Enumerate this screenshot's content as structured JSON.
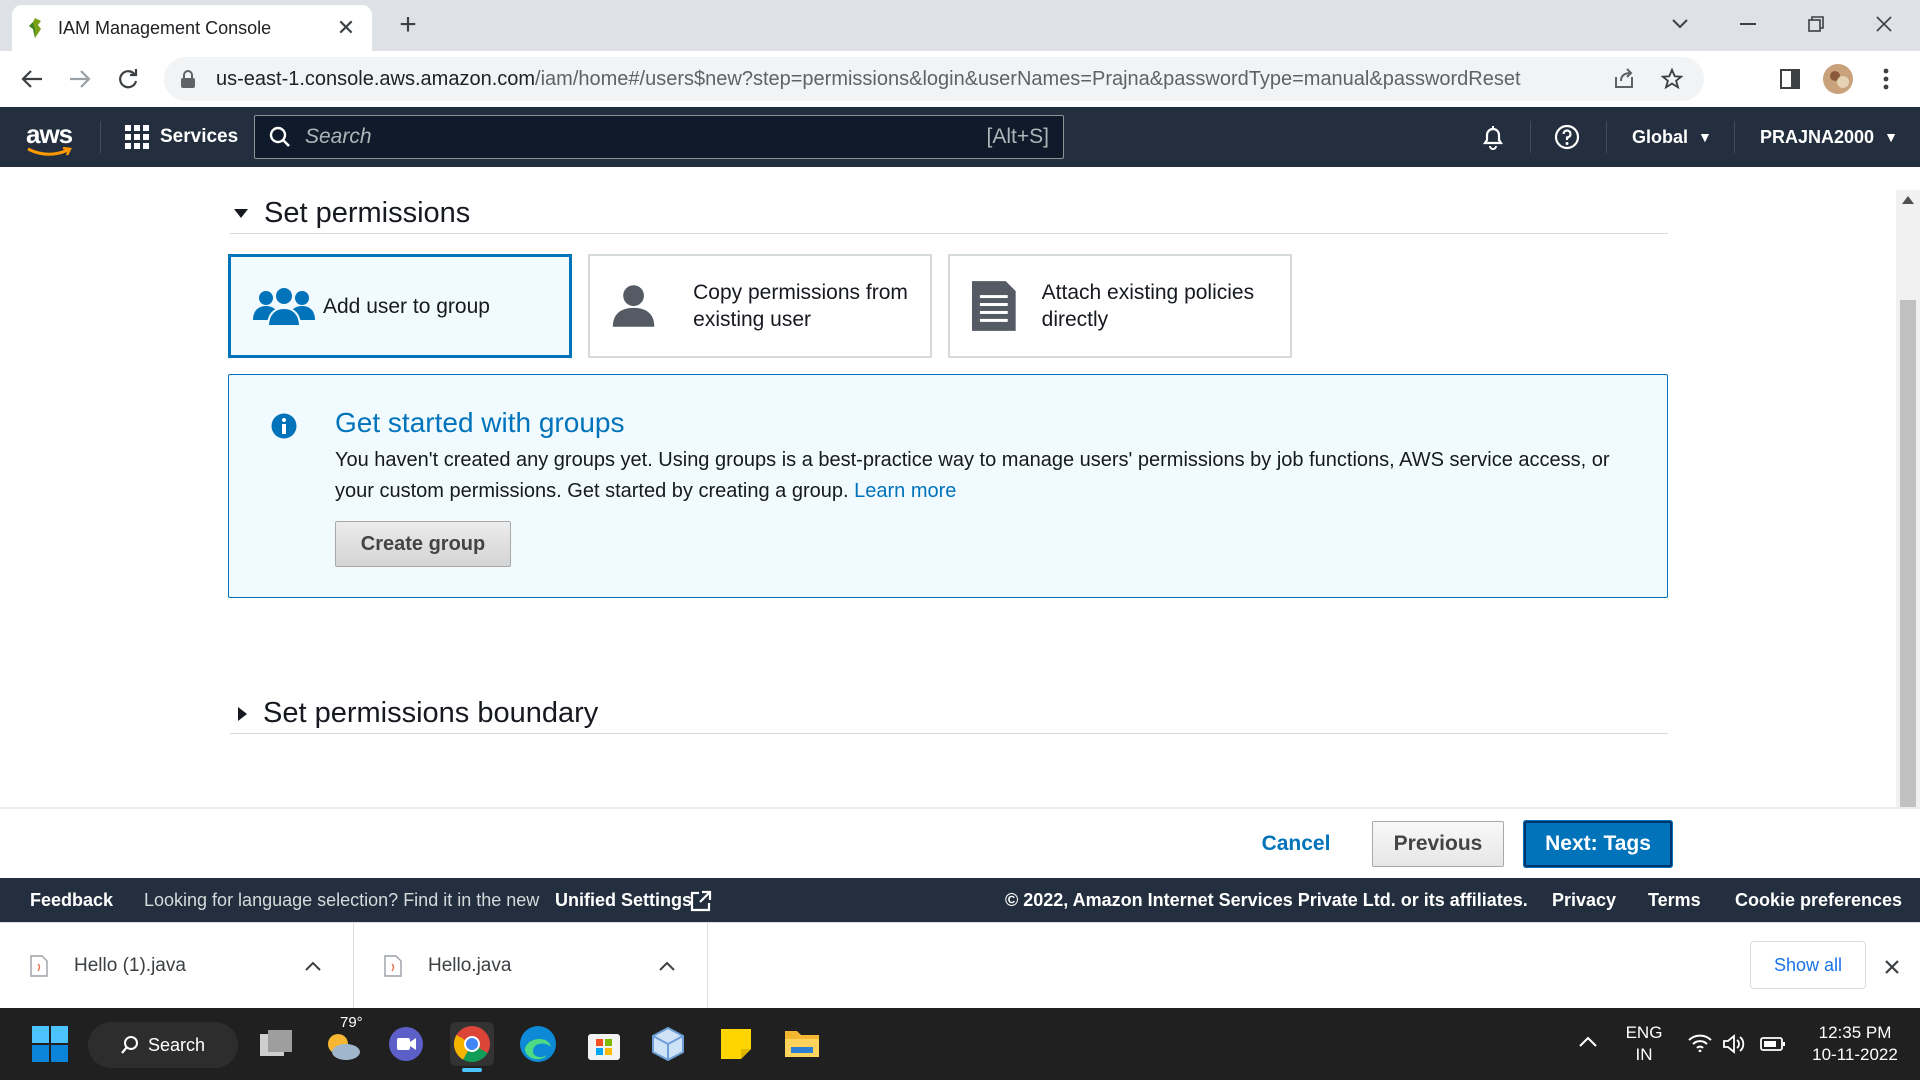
{
  "browser": {
    "tab_title": "IAM Management Console",
    "url_host": "us-east-1.console.aws.amazon.com",
    "url_path": "/iam/home#/users$new?step=permissions&login&userNames=Prajna&passwordType=manual&passwordReset"
  },
  "aws_nav": {
    "logo": "aws",
    "services_label": "Services",
    "search_placeholder": "Search",
    "search_shortcut": "[Alt+S]",
    "region": "Global",
    "account": "PRAJNA2000"
  },
  "permissions": {
    "section_title": "Set permissions",
    "options": [
      {
        "label": "Add user to group",
        "selected": true
      },
      {
        "label": "Copy permissions from existing user",
        "selected": false
      },
      {
        "label": "Attach existing policies directly",
        "selected": false
      }
    ],
    "info": {
      "title": "Get started with groups",
      "text": "You haven't created any groups yet. Using groups is a best-practice way to manage users' permissions by job functions, AWS service access, or your custom permissions. Get started by creating a group.",
      "link": "Learn more",
      "button": "Create group"
    },
    "boundary_title": "Set permissions boundary"
  },
  "actions": {
    "cancel": "Cancel",
    "previous": "Previous",
    "next": "Next: Tags"
  },
  "footer": {
    "feedback": "Feedback",
    "language_prompt": "Looking for language selection? Find it in the new",
    "unified_settings": "Unified Settings",
    "copyright": "© 2022, Amazon Internet Services Private Ltd. or its affiliates.",
    "privacy": "Privacy",
    "terms": "Terms",
    "cookies": "Cookie preferences"
  },
  "downloads": {
    "items": [
      {
        "name": "Hello (1).java"
      },
      {
        "name": "Hello.java"
      }
    ],
    "show_all": "Show all"
  },
  "taskbar": {
    "search_label": "Search",
    "weather_temp": "79°",
    "lang_line1": "ENG",
    "lang_line2": "IN",
    "time": "12:35 PM",
    "date": "10-11-2022"
  },
  "colors": {
    "aws_nav_bg": "#232f3e",
    "aws_blue": "#0073bb",
    "info_bg": "#f1faff"
  }
}
